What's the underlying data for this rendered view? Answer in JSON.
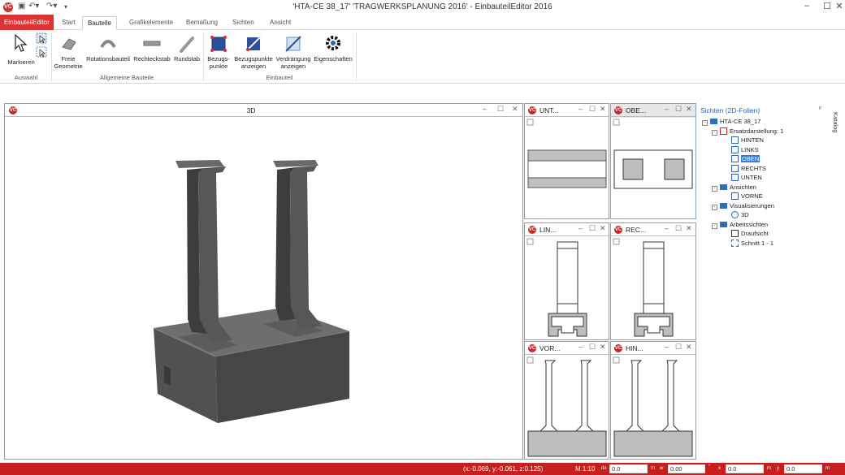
{
  "window": {
    "title": "'HTA-CE 38_17' 'TRAGWERKSPLANUNG 2016' - EinbauteilEditor 2016",
    "app_icon": "vc-logo-icon",
    "controls": [
      "–",
      "☐",
      "✕"
    ]
  },
  "quick_access": [
    "save-icon",
    "undo-icon",
    "redo-icon",
    "customize-icon"
  ],
  "tabs": {
    "app": "EinbauteilEditor",
    "items": [
      "Start",
      "Bauteile",
      "Grafikelemente",
      "Bemaßung",
      "Sichten",
      "Ansicht"
    ],
    "active": "Bauteile"
  },
  "ribbon": {
    "groups": [
      {
        "label": "Auswahl",
        "buttons": [
          {
            "label": "Markieren",
            "icon": "cursor-icon"
          }
        ]
      },
      {
        "label": "Allgemeine Bauteile",
        "buttons": [
          {
            "label": "Freie Geometrie",
            "icon": "free-geometry-icon"
          },
          {
            "label": "Rotationsbauteil",
            "icon": "rotation-part-icon"
          },
          {
            "label": "Rechteckstab",
            "icon": "rect-bar-icon"
          },
          {
            "label": "Rundstab",
            "icon": "round-bar-icon"
          }
        ]
      },
      {
        "label": "Einbauteil",
        "buttons": [
          {
            "label": "Bezugs-punkte",
            "icon": "reference-points-icon"
          },
          {
            "label": "Bezugspunkte anzeigen",
            "icon": "show-reference-points-icon"
          },
          {
            "label": "Verdrängung anzeigen",
            "icon": "show-displacement-icon"
          },
          {
            "label": "Eigenschaften",
            "icon": "properties-gear-icon"
          }
        ]
      }
    ]
  },
  "views": {
    "main": {
      "title": "3D"
    },
    "small": [
      {
        "title": "UNT..."
      },
      {
        "title": "OBE..."
      },
      {
        "title": "LIN..."
      },
      {
        "title": "REC..."
      },
      {
        "title": "VOR..."
      },
      {
        "title": "HIN..."
      }
    ]
  },
  "panel": {
    "title": "Sichten (2D-Folien)",
    "side_tab": "Katalog",
    "pin": "ᵖ",
    "tree": [
      {
        "label": "HTA-CE 38_17",
        "level": 0,
        "expander": "-",
        "icon": "folder-icon"
      },
      {
        "label": "Ersatzdarstellung: 1",
        "level": 1,
        "expander": "-",
        "icon": "substitute-view-icon"
      },
      {
        "label": "HINTEN",
        "level": 2,
        "icon": "view-icon"
      },
      {
        "label": "LINKS",
        "level": 2,
        "icon": "view-icon"
      },
      {
        "label": "OBEN",
        "level": 2,
        "icon": "view-icon",
        "selected": true
      },
      {
        "label": "RECHTS",
        "level": 2,
        "icon": "view-icon"
      },
      {
        "label": "UNTEN",
        "level": 2,
        "icon": "view-icon"
      },
      {
        "label": "Ansichten",
        "level": 1,
        "expander": "-",
        "icon": "folder-icon"
      },
      {
        "label": "VORNE",
        "level": 2,
        "icon": "view-icon"
      },
      {
        "label": "Visualisierungen",
        "level": 1,
        "expander": "-",
        "icon": "folder-icon"
      },
      {
        "label": "3D",
        "level": 2,
        "icon": "visualization-icon"
      },
      {
        "label": "Arbeitssichten",
        "level": 1,
        "expander": "-",
        "icon": "folder-icon"
      },
      {
        "label": "Draufsicht",
        "level": 2,
        "icon": "top-view-icon"
      },
      {
        "label": "Schnitt 1 - 1",
        "level": 2,
        "icon": "section-icon"
      }
    ]
  },
  "status": {
    "coords": "(x:-0.069, y:-0.061, z:0.125)",
    "scale": "M 1:10",
    "fields": [
      {
        "label": "dx",
        "value": "0.0",
        "unit": "m"
      },
      {
        "label": "w",
        "value": "0.00",
        "unit": "°"
      },
      {
        "label": "x",
        "value": "0.0",
        "unit": "m"
      },
      {
        "label": "y",
        "value": "0.0",
        "unit": "m"
      }
    ]
  },
  "colors": {
    "accent": "#c71e1e",
    "tree_blue": "#2f6db5",
    "selection": "#3a7bd5"
  }
}
